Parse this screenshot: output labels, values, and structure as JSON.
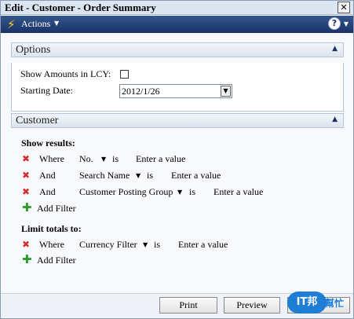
{
  "window": {
    "title": "Edit - Customer - Order Summary",
    "close_glyph": "✕"
  },
  "toolbar": {
    "actions_label": "Actions",
    "help_glyph": "?"
  },
  "options": {
    "header": "Options",
    "show_amounts_label": "Show Amounts in LCY:",
    "show_amounts_checked": false,
    "starting_date_label": "Starting Date:",
    "starting_date_value": "2012/1/26"
  },
  "customer": {
    "header": "Customer",
    "show_results_title": "Show results:",
    "filters": [
      {
        "connector": "Where",
        "field": "No.",
        "op": "is",
        "value": "Enter a value"
      },
      {
        "connector": "And",
        "field": "Search Name",
        "op": "is",
        "value": "Enter a value"
      },
      {
        "connector": "And",
        "field": "Customer Posting Group",
        "op": "is",
        "value": "Enter a value"
      }
    ],
    "add_filter_label": "Add Filter",
    "limit_totals_title": "Limit totals to:",
    "limit_filters": [
      {
        "connector": "Where",
        "field": "Currency Filter",
        "op": "is",
        "value": "Enter a value"
      }
    ],
    "add_filter_label_2": "Add Filter"
  },
  "footer": {
    "print_label": "Print",
    "preview_label": "Preview",
    "logo_text": "IT邦",
    "logo_text_2": "幫忙"
  },
  "colors": {
    "toolbar_bg": "#1a3266",
    "remove_icon": "#d32f2f",
    "add_icon": "#2e9b2e"
  }
}
